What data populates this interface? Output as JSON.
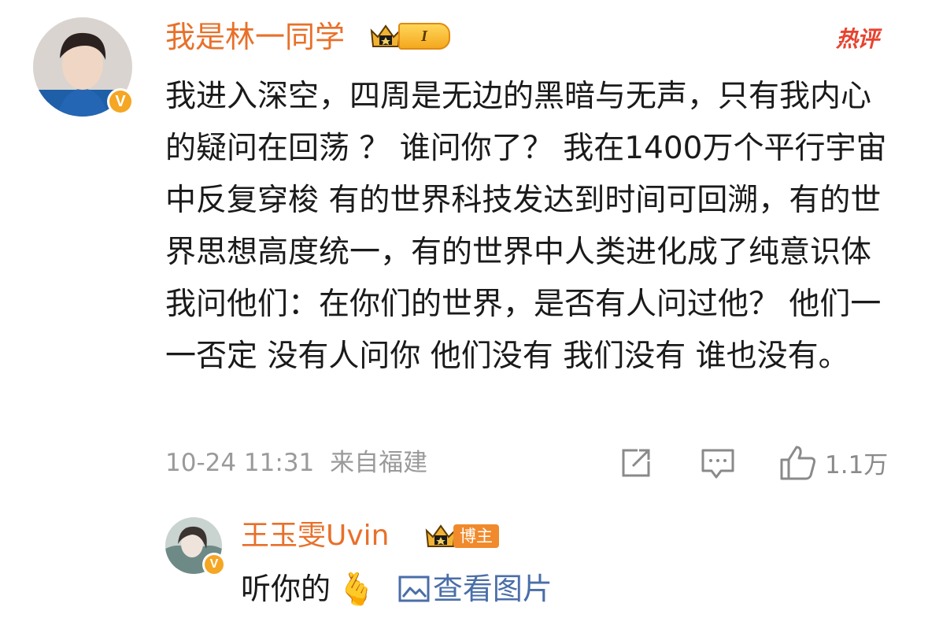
{
  "comment": {
    "author": "我是林一同学",
    "level": "I",
    "hot_label": "热评",
    "verified_mark": "V",
    "text": "我进入深空，四周是无边的黑暗与无声，只有我内心的疑问在回荡 ？ 谁问你了？ 我在1400万个平行宇宙中反复穿梭 有的世界科技发达到时间可回溯，有的世界思想高度统一，有的世界中人类进化成了纯意识体 我问他们：在你们的世界，是否有人问过他？ 他们一一否定 没有人问你 他们没有 我们没有 谁也没有。",
    "time": "10-24 11:31",
    "location": "来自福建",
    "likes": "1.1万",
    "icons": {
      "share": "share-icon",
      "reply": "comment-icon",
      "like": "thumbs-up-icon"
    }
  },
  "reply": {
    "author": "王玉雯Uvin",
    "badge": "博主",
    "verified_mark": "V",
    "text": "听你的",
    "emoji": "🫰",
    "view_image_label": "查看图片",
    "icons": {
      "image": "image-icon"
    }
  },
  "colors": {
    "username": "#e8702a",
    "hot": "#e8432f",
    "link": "#4a6ea8",
    "verified": "#f5a623"
  }
}
